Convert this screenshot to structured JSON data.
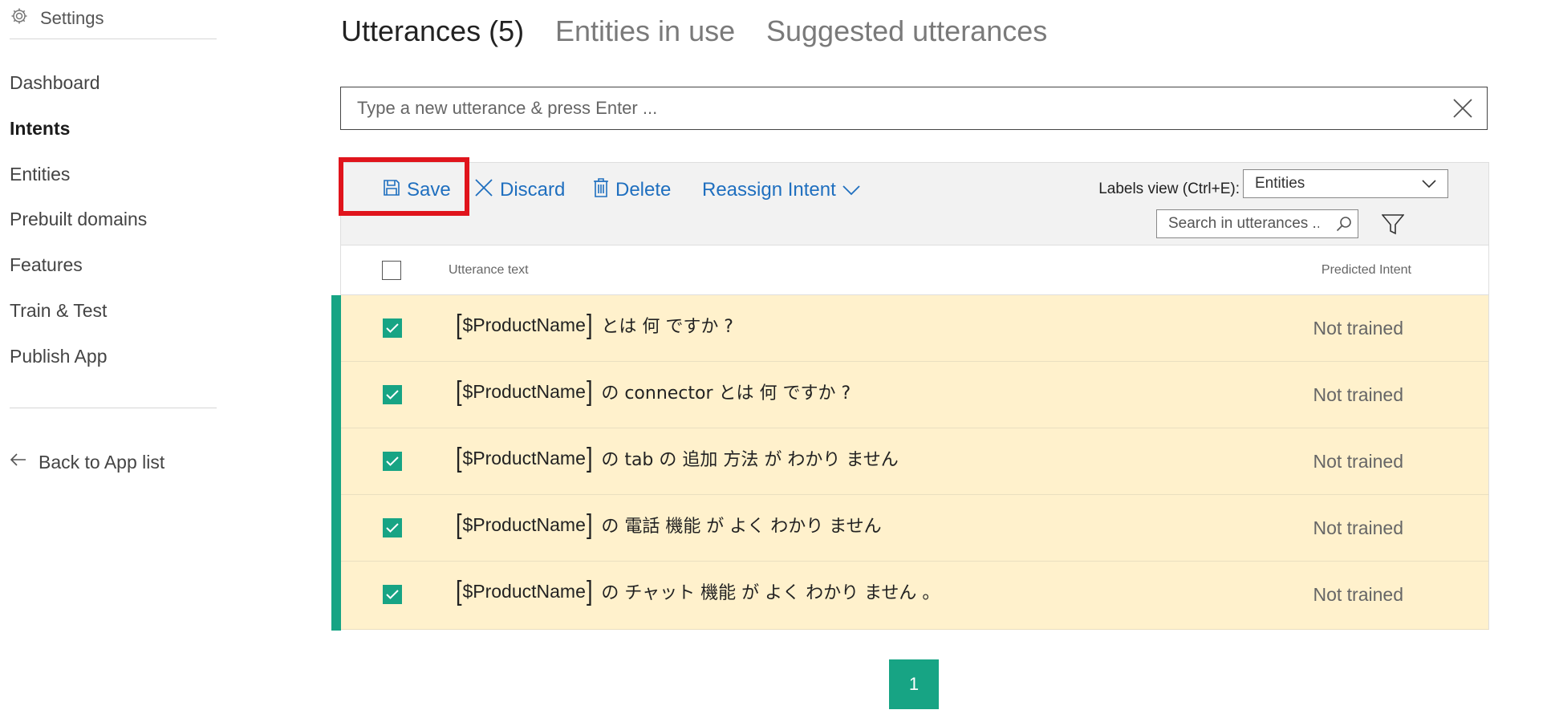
{
  "sidebar": {
    "settings_label": "Settings",
    "items": [
      {
        "label": "Dashboard",
        "active": false
      },
      {
        "label": "Intents",
        "active": true
      },
      {
        "label": "Entities",
        "active": false
      },
      {
        "label": "Prebuilt domains",
        "active": false
      },
      {
        "label": "Features",
        "active": false
      },
      {
        "label": "Train & Test",
        "active": false
      },
      {
        "label": "Publish App",
        "active": false
      }
    ],
    "back_label": "Back to App list"
  },
  "tabs": [
    {
      "label": "Utterances (5)",
      "active": true
    },
    {
      "label": "Entities in use",
      "active": false
    },
    {
      "label": "Suggested utterances",
      "active": false
    }
  ],
  "utterance_input": {
    "placeholder": "Type a new utterance & press Enter ...",
    "value": ""
  },
  "toolbar": {
    "save_label": "Save",
    "discard_label": "Discard",
    "delete_label": "Delete",
    "reassign_label": "Reassign Intent",
    "labels_view_label": "Labels view (Ctrl+E):",
    "labels_view_value": "Entities",
    "search_placeholder": "Search in utterances ..."
  },
  "table": {
    "col_utterance": "Utterance text",
    "col_predicted": "Predicted Intent",
    "rows": [
      {
        "entity": "$ProductName",
        "text": "とは 何 ですか ?",
        "predicted": "Not trained",
        "checked": true
      },
      {
        "entity": "$ProductName",
        "text": "の connector とは 何 ですか ?",
        "predicted": "Not trained",
        "checked": true
      },
      {
        "entity": "$ProductName",
        "text": "の tab の 追加 方法 が わかり ません",
        "predicted": "Not trained",
        "checked": true
      },
      {
        "entity": "$ProductName",
        "text": "の 電話 機能 が よく わかり ません",
        "predicted": "Not trained",
        "checked": true
      },
      {
        "entity": "$ProductName",
        "text": "の チャット 機能 が よく わかり ません 。",
        "predicted": "Not trained",
        "checked": true
      }
    ]
  },
  "pagination": {
    "current_page": "1"
  },
  "colors": {
    "accent": "#17a484",
    "link": "#1f6fbf",
    "row_highlight": "#fff1cc",
    "save_highlight": "#e0141c"
  }
}
